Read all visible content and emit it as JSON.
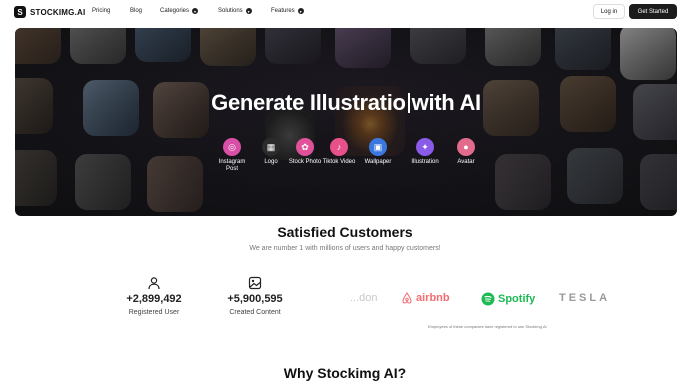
{
  "nav": {
    "logo_mark": "S",
    "logo_text": "STOCKIMG.AI",
    "items": [
      {
        "label": "Pricing",
        "has_dropdown": false
      },
      {
        "label": "Blog",
        "has_dropdown": false
      },
      {
        "label": "Categories",
        "has_dropdown": true
      },
      {
        "label": "Solutions",
        "has_dropdown": true
      },
      {
        "label": "Features",
        "has_dropdown": true
      }
    ],
    "login_label": "Log in",
    "cta_label": "Get Started"
  },
  "hero": {
    "title_part1": "Generate Illustratio",
    "title_part2": "with AI",
    "categories": [
      {
        "label": "Instagram Post",
        "icon": "instagram-icon",
        "color": "#d94ea6",
        "glyph": "◎"
      },
      {
        "label": "Logo",
        "icon": "grid-icon",
        "color": "#2b2b2b",
        "glyph": "▦"
      },
      {
        "label": "Stock Photo",
        "icon": "camera-icon",
        "color": "#e0519a",
        "glyph": "✿"
      },
      {
        "label": "Tiktok Video",
        "icon": "tiktok-icon",
        "color": "#e8508a",
        "glyph": "♪"
      },
      {
        "label": "Wallpaper",
        "icon": "image-icon",
        "color": "#3a78e0",
        "glyph": "▣"
      },
      {
        "label": "Illustration",
        "icon": "sparkle-icon",
        "color": "#8a5ae8",
        "glyph": "✦"
      },
      {
        "label": "Avatar",
        "icon": "user-icon",
        "color": "#e26a8c",
        "glyph": "●"
      }
    ]
  },
  "satisfied": {
    "title": "Satisfied Customers",
    "subtitle": "We are number 1 with millions of users and happy customers!",
    "stats": [
      {
        "value": "+2,899,492",
        "label": "Registered User",
        "icon": "user-outline-icon"
      },
      {
        "value": "+5,900,595",
        "label": "Created Content",
        "icon": "image-outline-icon"
      }
    ],
    "brands": [
      {
        "name": "...don",
        "icon": "partial-brand-logo",
        "color": "#c9c9c9"
      },
      {
        "name": "airbnb",
        "icon": "airbnb-logo",
        "color": "#f36d73"
      },
      {
        "name": "Spotify",
        "icon": "spotify-logo",
        "color": "#1db954"
      },
      {
        "name": "TESLA",
        "icon": "tesla-logo",
        "color": "#9a9a9a"
      }
    ],
    "brands_note": "Employees of these companies have registered to use Stockimg.Ai"
  },
  "why": {
    "title": "Why Stockimg AI?"
  }
}
